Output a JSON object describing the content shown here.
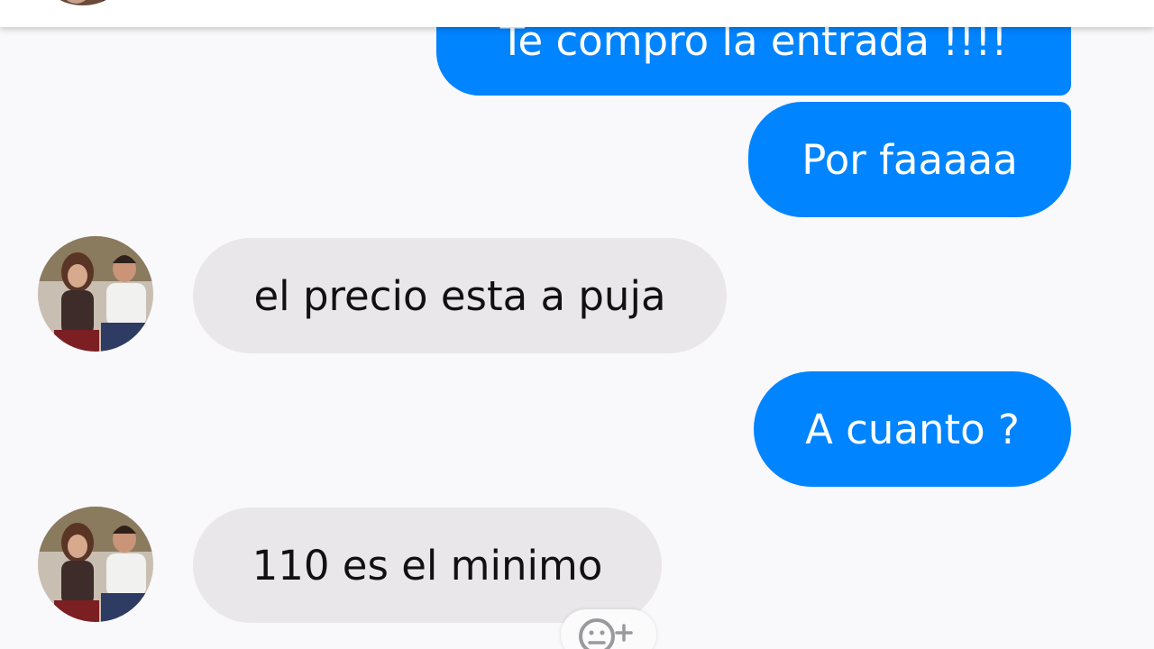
{
  "theme": {
    "outgoing_color": "#0084ff",
    "incoming_color": "#e9e7ea",
    "background": "#f9f8fb"
  },
  "messages": [
    {
      "direction": "outgoing",
      "text": "Te compro  la entrada !!!!"
    },
    {
      "direction": "outgoing",
      "text": "Por faaaaa"
    },
    {
      "direction": "incoming",
      "text": "el precio esta a puja"
    },
    {
      "direction": "outgoing",
      "text": "A cuanto ?"
    },
    {
      "direction": "incoming",
      "text": "110 es el minimo"
    }
  ],
  "icons": {
    "avatar": "contact-avatar",
    "reaction": "add-reaction-icon"
  }
}
